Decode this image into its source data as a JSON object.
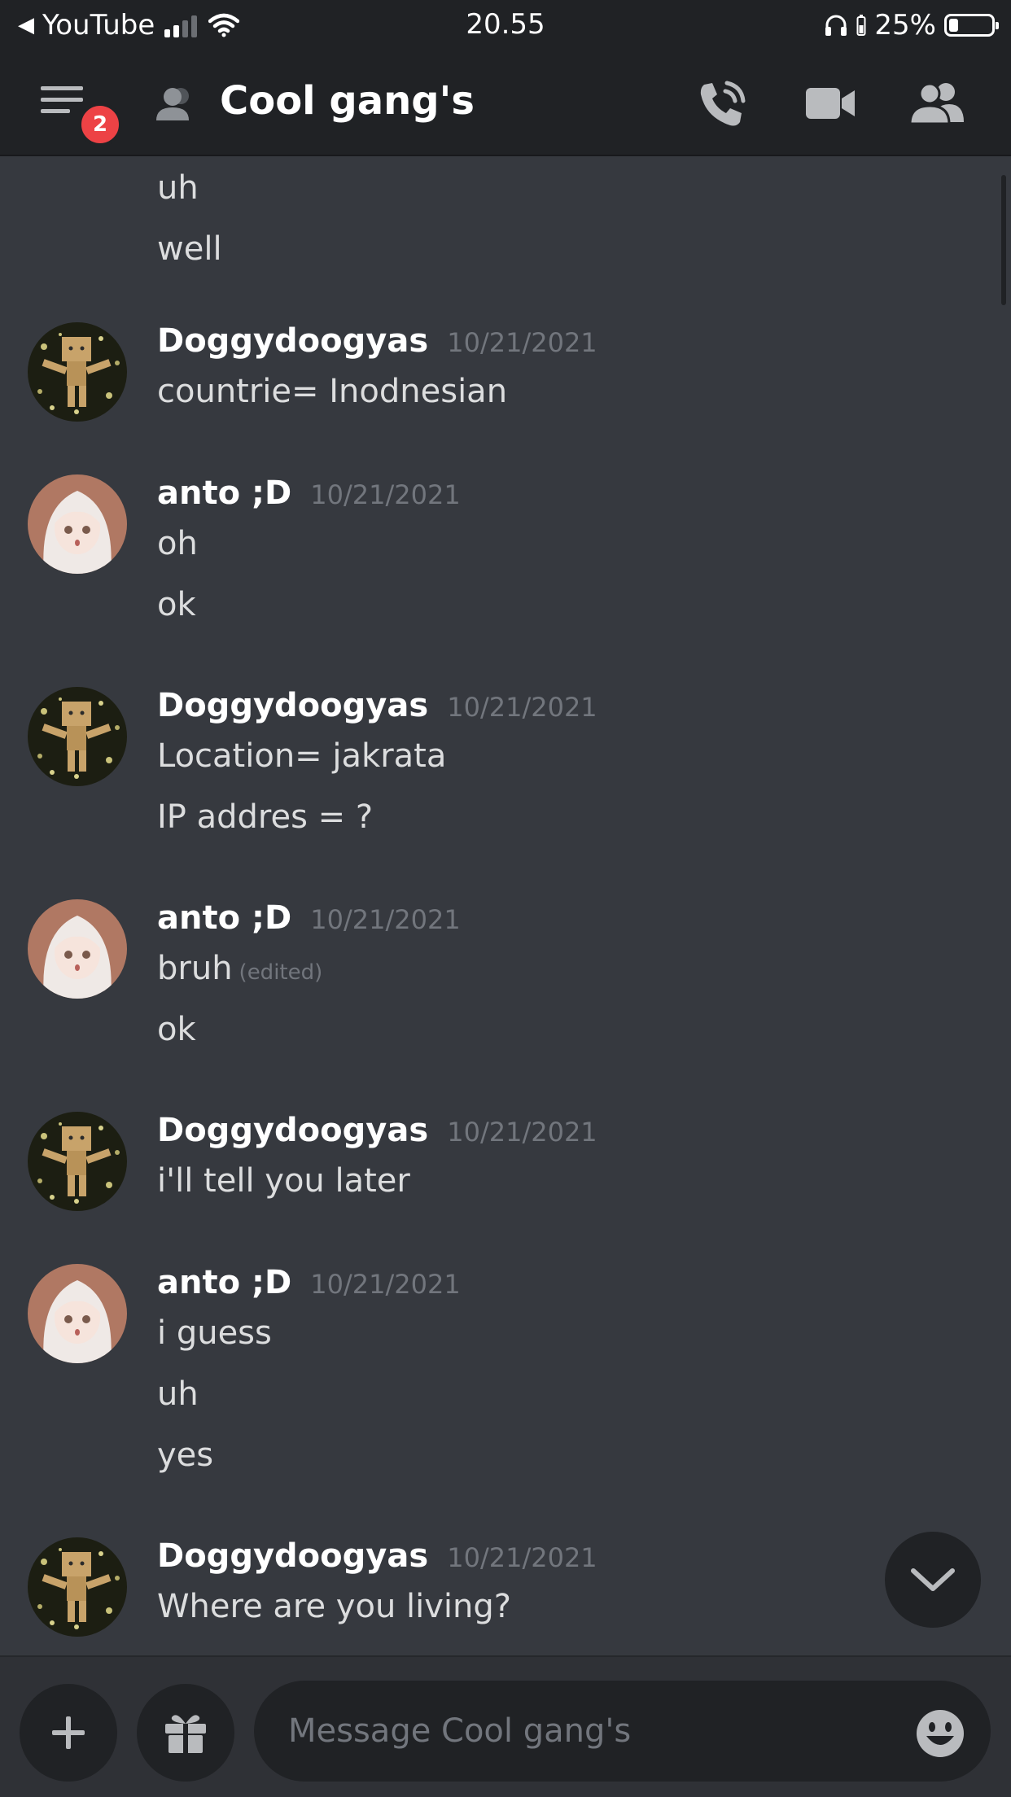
{
  "status_bar": {
    "back_app": "YouTube",
    "time": "20.55",
    "battery": "25%",
    "battery_level": 0.25
  },
  "header": {
    "title": "Cool gang's",
    "unread_badge": "2",
    "icons": [
      "menu-icon",
      "dm-people-icon",
      "voice-call-icon",
      "video-call-icon",
      "members-icon"
    ]
  },
  "messages": [
    {
      "author": "",
      "timestamp": "",
      "lines": [
        "uh",
        "well"
      ]
    },
    {
      "author": "Doggydoogyas",
      "timestamp": "10/21/2021",
      "avatar": "box-robot",
      "lines": [
        "countrie= Inodnesian"
      ]
    },
    {
      "author": "anto  ;D",
      "timestamp": "10/21/2021",
      "avatar": "anime-girl",
      "lines": [
        "oh",
        "ok"
      ]
    },
    {
      "author": "Doggydoogyas",
      "timestamp": "10/21/2021",
      "avatar": "box-robot",
      "lines": [
        "Location= jakrata",
        "IP addres = ?"
      ]
    },
    {
      "author": "anto  ;D",
      "timestamp": "10/21/2021",
      "avatar": "anime-girl",
      "lines": [
        "bruh",
        "ok"
      ],
      "edited_label": "(edited)"
    },
    {
      "author": "Doggydoogyas",
      "timestamp": "10/21/2021",
      "avatar": "box-robot",
      "lines": [
        "i'll tell you later"
      ]
    },
    {
      "author": "anto  ;D",
      "timestamp": "10/21/2021",
      "avatar": "anime-girl",
      "lines": [
        "i guess",
        "uh",
        "yes"
      ]
    },
    {
      "author": "Doggydoogyas",
      "timestamp": "10/21/2021",
      "avatar": "box-robot",
      "lines": [
        "Where are you living?"
      ]
    }
  ],
  "composer": {
    "placeholder": "Message Cool gang's",
    "icons": [
      "plus-icon",
      "gift-icon",
      "emoji-icon"
    ]
  },
  "colors": {
    "background": "#36393f",
    "header": "#202225",
    "badge": "#ed4245",
    "muted_text": "#72767d"
  }
}
